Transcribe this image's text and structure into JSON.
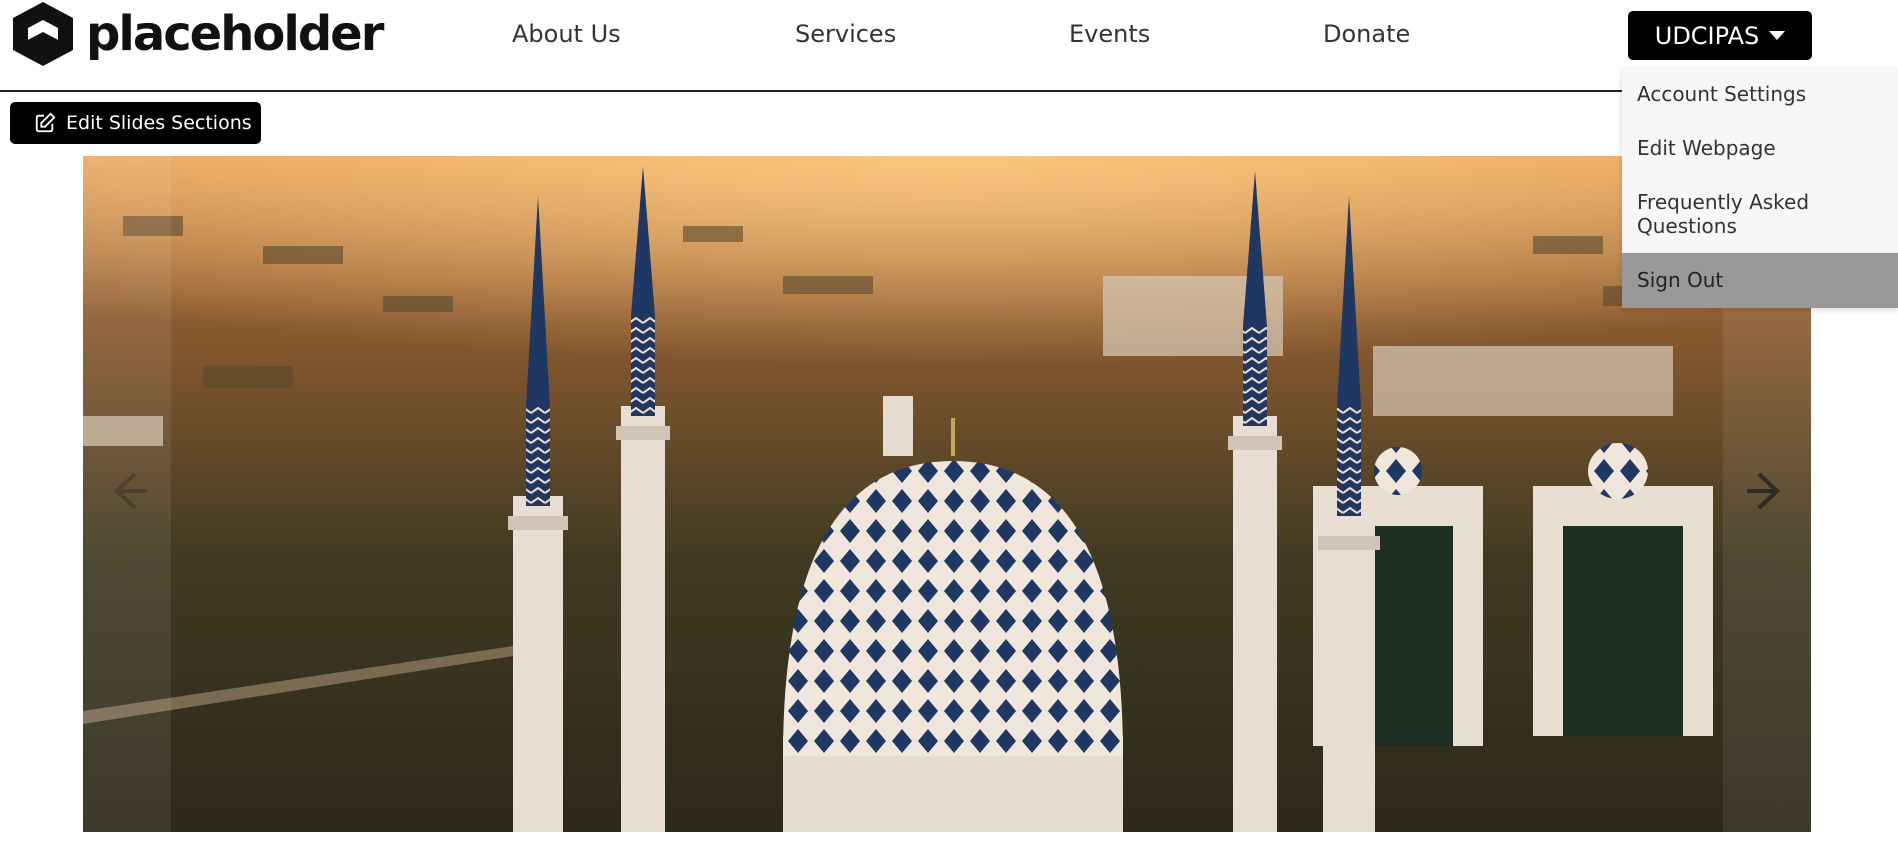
{
  "brand": {
    "logo_text": "placeholder",
    "logo_icon": "hexagon-logo-icon"
  },
  "nav": {
    "about": "About Us",
    "services": "Services",
    "events": "Events",
    "donate": "Donate"
  },
  "user_menu": {
    "label": "UDCIPAS",
    "items": [
      "Account Settings",
      "Edit Webpage",
      "Frequently Asked Questions",
      "Sign Out"
    ],
    "highlighted_index": 3
  },
  "toolbar": {
    "edit_slides_label": "Edit Slides Sections",
    "edit_icon": "edit-icon"
  },
  "carousel": {
    "prev_icon": "chevron-left-icon",
    "next_icon": "chevron-right-icon"
  },
  "colors": {
    "button_bg": "#000000",
    "dropdown_bg": "#f7f7f7",
    "dropdown_active": "#999999"
  }
}
